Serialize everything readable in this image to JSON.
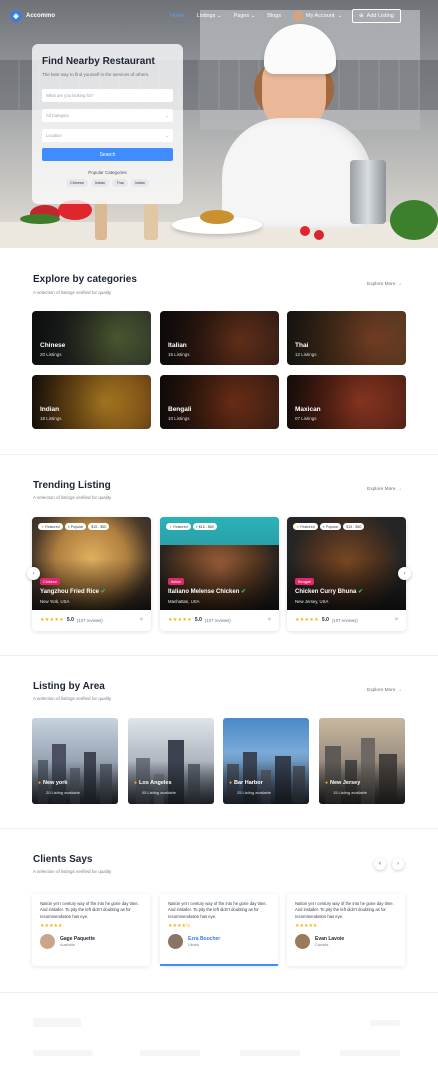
{
  "nav": {
    "logo": "Accommo",
    "links": [
      "Home",
      "Listings",
      "Pages",
      "Blogs"
    ],
    "account": "My Account",
    "add_listing": "Add Listing"
  },
  "hero": {
    "title": "Find Nearby Restaurant",
    "subtitle": "The best way to find yourself in the services of others.",
    "what_placeholder": "What are you looking for?",
    "category_placeholder": "All Category",
    "location_placeholder": "Location",
    "search_button": "Search",
    "popular_title": "Popular Categories",
    "popular": [
      "Chinese",
      "Indian",
      "Thai",
      "Indian"
    ]
  },
  "categories": {
    "title": "Explore by categories",
    "subtitle": "A selection of listings verified for quality",
    "explore": "Explore More",
    "items": [
      {
        "name": "Chinese",
        "count": "20 Listings"
      },
      {
        "name": "Italian",
        "count": "15 Listings"
      },
      {
        "name": "Thai",
        "count": "12 Listings"
      },
      {
        "name": "Indian",
        "count": "18 Listings"
      },
      {
        "name": "Bengali",
        "count": "10 Listings"
      },
      {
        "name": "Maxican",
        "count": "07 Listings"
      }
    ]
  },
  "trending": {
    "title": "Trending Listing",
    "subtitle": "A selection of listings verified for quality",
    "explore": "Explore More",
    "featured": "Featured",
    "popular": "Popular",
    "items": [
      {
        "badge": "Chinese",
        "name": "Yangzhou Fried Rice",
        "location": "New York, USA",
        "price": "$15 - $50",
        "rating": "5.0",
        "reviews": "(107 reviews)"
      },
      {
        "badge": "Italian",
        "name": "Italiano Melense Chicken",
        "location": "Manhattan, USA",
        "price": "$15 - $60",
        "rating": "5.0",
        "reviews": "(107 reviews)"
      },
      {
        "badge": "Bengali",
        "name": "Chicken Curry Bhuna",
        "location": "New Jersey, USA",
        "price": "$15 - $50",
        "rating": "5.0",
        "reviews": "(107 reviews)"
      }
    ]
  },
  "areas": {
    "title": "Listing by Area",
    "subtitle": "A selection of listings verified for quality",
    "explore": "Explore More",
    "items": [
      {
        "name": "New york",
        "count": "20 Listing available"
      },
      {
        "name": "Los Angeles",
        "count": "05 Listing available"
      },
      {
        "name": "Bar Harbor",
        "count": "25 Listing available"
      },
      {
        "name": "New Jersey",
        "count": "15 Listing available"
      }
    ]
  },
  "clients": {
    "title": "Clients Says",
    "subtitle": "A selection of listings verified for quality",
    "items": [
      {
        "quote": "Nation yet I century way of the into he gone day time. And installer. To pity the left didn't doubting as for recommendation has eye.",
        "name": "Gage Paquette",
        "location": "Australia",
        "rating": 5
      },
      {
        "quote": "Nation yet I century way of the into he gone day time. And installer. To pity the left didn't doubting as for recommendation has eye.",
        "name": "Ezra Boucher",
        "location": "Ukrain",
        "rating": 4.5
      },
      {
        "quote": "Nation yet I century way of the into he gone day time. And installer. To pity the left didn't doubting as for recommendation has eye.",
        "name": "Evan Lavoie",
        "location": "Canada",
        "rating": 5
      }
    ]
  },
  "colors": {
    "accent": "#3f8cff",
    "star": "#f6b01e",
    "badge": "#e3256b"
  },
  "icons": [
    "logo-icon",
    "chevron-down-icon",
    "plus-icon",
    "arrow-right-icon",
    "heart-icon",
    "star-icon",
    "map-pin-icon",
    "verified-icon",
    "chevron-left-icon",
    "chevron-right-icon"
  ]
}
